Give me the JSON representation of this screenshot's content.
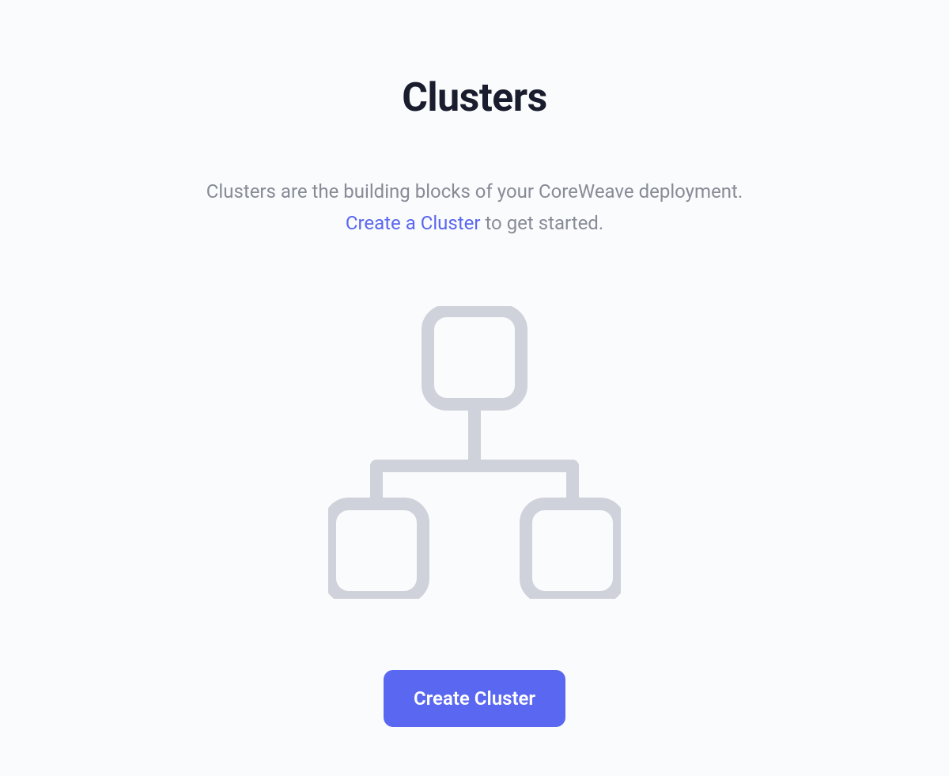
{
  "title": "Clusters",
  "description": {
    "text_before_link": "Clusters are the building blocks of your CoreWeave deployment.",
    "link_text": "Create a Cluster",
    "text_after_link": " to get started."
  },
  "button": {
    "create_label": "Create Cluster"
  },
  "colors": {
    "accent": "#5a67f0",
    "text_primary": "#1a1d2e",
    "text_secondary": "#878b96",
    "icon_stroke": "#d0d2db",
    "background": "#fafbfd"
  }
}
